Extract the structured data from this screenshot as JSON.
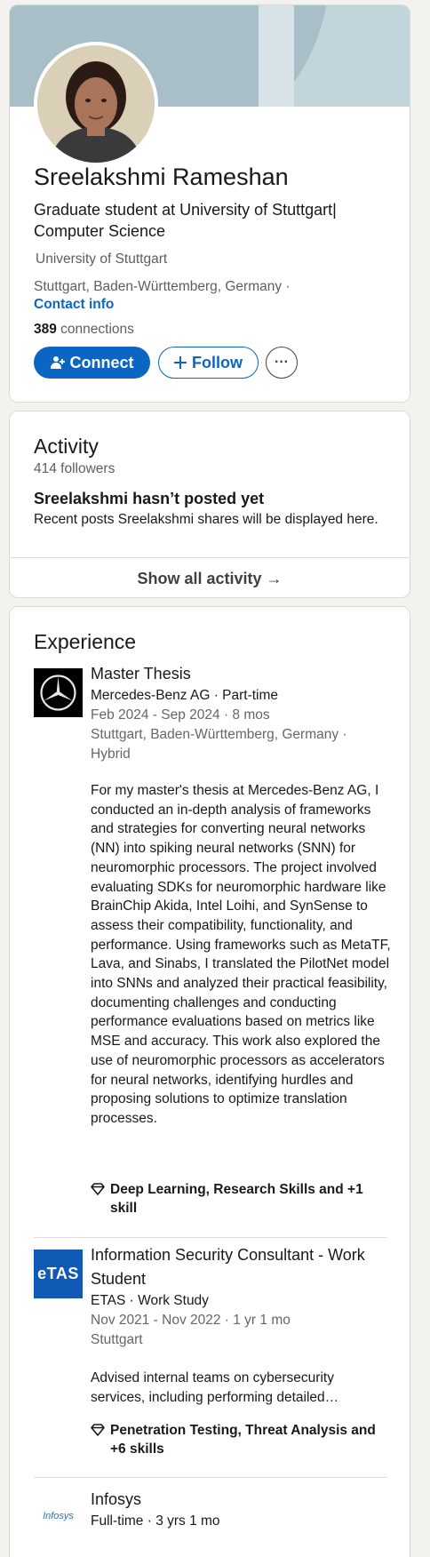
{
  "profile": {
    "name": "Sreelakshmi Rameshan",
    "headline": "Graduate student at University of Stuttgart| Computer Science",
    "school": "University of Stuttgart",
    "location": "Stuttgart, Baden-Württemberg, Germany ·",
    "contact_info": "Contact info",
    "connections_count": "389",
    "connections_label": " connections",
    "buttons": {
      "connect": "Connect",
      "follow": "Follow",
      "more": "···"
    }
  },
  "activity": {
    "title": "Activity",
    "followers": "414 followers",
    "empty_title": "Sreelakshmi hasn’t posted yet",
    "empty_sub": "Recent posts Sreelakshmi shares will be displayed here.",
    "show_all": "Show all activity →"
  },
  "experience": {
    "title": "Experience",
    "items": [
      {
        "title": "Master Thesis",
        "company": "Mercedes-Benz AG · Part-time",
        "dates": "Feb 2024 - Sep 2024 · 8 mos",
        "location": "Stuttgart, Baden-Württemberg, Germany · Hybrid",
        "description": "For my master's thesis at Mercedes-Benz AG, I conducted an in-depth analysis of frameworks and strategies for converting neural networks (NN) into spiking neural networks (SNN) for neuromorphic processors. The project involved evaluating SDKs for neuromorphic hardware like BrainChip Akida, Intel Loihi, and SynSense to assess their compatibility, functionality, and performance. Using frameworks such as MetaTF, Lava, and Sinabs, I translated the PilotNet model into SNNs and analyzed their practical feasibility, documenting challenges and conducting performance evaluations based on metrics like MSE and accuracy. This work also explored the use of neuromorphic processors as accelerators for neural networks, identifying hurdles and proposing solutions to optimize translation processes.",
        "skills": "Deep Learning, Research Skills and +1 skill",
        "logo_icon": "mercedes-benz-star-icon"
      },
      {
        "title": "Information Security Consultant - Work Student",
        "company": "ETAS · Work Study",
        "dates": "Nov 2021 - Nov 2022 · 1 yr 1 mo",
        "location": "Stuttgart",
        "description_line1": "Advised internal teams on cybersecurity",
        "description_line2": "services, including performing detailed…",
        "skills": "Penetration Testing, Threat Analysis and +6 skills",
        "logo_text": "eTAS"
      },
      {
        "title": "Infosys",
        "company": "Full-time · 3 yrs 1 mo",
        "logo_text": "Infosys"
      }
    ]
  },
  "colors": {
    "accent": "#0a66c2",
    "page_bg": "#f4f2ee",
    "banner": "#c2d5da",
    "etas": "#1059b5"
  }
}
